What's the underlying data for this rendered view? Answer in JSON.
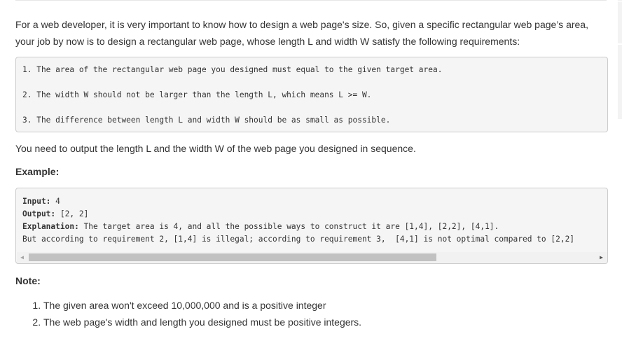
{
  "problem": {
    "intro_line1": "For a web developer, it is very important to know how to design a web page's size. So, given a specific rectangular web page’s area,",
    "intro_line2": "your job by now is to design a rectangular web page, whose length L and width W satisfy the following requirements:",
    "requirements": [
      "1. The area of the rectangular web page you designed must equal to the given target area.",
      "2. The width W should not be larger than the length L, which means L >= W.",
      "3. The difference between length L and width W should be as small as possible."
    ],
    "output_instruction": "You need to output the length L and the width W of the web page you designed in sequence.",
    "example_label": "Example:",
    "example": {
      "input_label": "Input:",
      "input_value": " 4",
      "output_label": "Output:",
      "output_value": " [2, 2]",
      "explanation_label": "Explanation:",
      "explanation_value": " The target area is 4, and all the possible ways to construct it are [1,4], [2,2], [4,1].",
      "explanation_cont": "But according to requirement 2, [1,4] is illegal; according to requirement 3,  [4,1] is not optimal compared to [2,2]"
    },
    "scroll": {
      "left_arrow": "◀",
      "right_arrow": "▶",
      "position": 0
    },
    "note_label": "Note:",
    "notes": [
      "The given area won't exceed 10,000,000 and is a positive integer",
      "The web page's width and length you designed must be positive integers."
    ]
  }
}
